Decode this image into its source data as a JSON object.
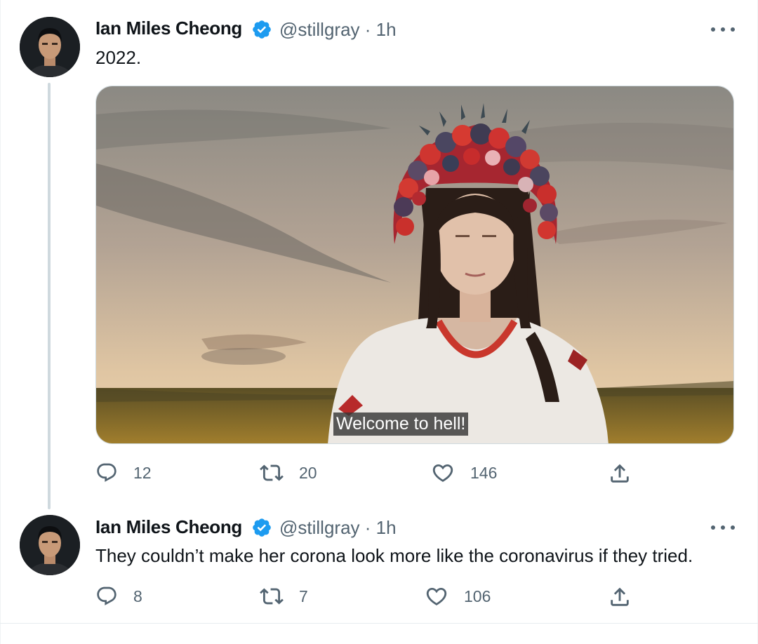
{
  "tweets": [
    {
      "author": "Ian Miles Cheong",
      "handle": "@stillgray",
      "separator": "·",
      "time": "1h",
      "text": "2022.",
      "media": {
        "caption": "Welcome to hell!"
      },
      "actions": {
        "replies": "12",
        "retweets": "20",
        "likes": "146"
      },
      "icons": [
        "reply-icon",
        "retweet-icon",
        "like-icon",
        "share-icon"
      ]
    },
    {
      "author": "Ian Miles Cheong",
      "handle": "@stillgray",
      "separator": "·",
      "time": "1h",
      "text": "They couldn’t make her corona look more like the coronavirus if they tried.",
      "actions": {
        "replies": "8",
        "retweets": "7",
        "likes": "106"
      },
      "icons": [
        "reply-icon",
        "retweet-icon",
        "like-icon",
        "share-icon"
      ]
    }
  ],
  "colors": {
    "verified": "#1d9bf0",
    "secondary_text": "#536471",
    "thread_line": "#cfd9de"
  }
}
